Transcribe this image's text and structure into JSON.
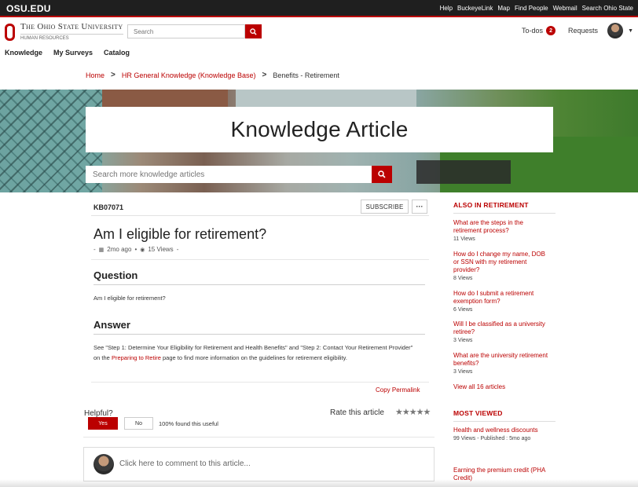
{
  "osu_bar": {
    "brand": "OSU.EDU",
    "links": [
      "Help",
      "BuckeyeLink",
      "Map",
      "Find People",
      "Webmail",
      "Search Ohio State"
    ]
  },
  "header": {
    "university": "The Ohio State University",
    "department": "HUMAN RESOURCES",
    "search_placeholder": "Search",
    "todos_label": "To-dos",
    "todos_count": "2",
    "requests_label": "Requests"
  },
  "nav": {
    "items": [
      "Knowledge",
      "My Surveys",
      "Catalog"
    ]
  },
  "breadcrumb": {
    "home": "Home",
    "parent": "HR General Knowledge (Knowledge Base)",
    "current": "Benefits - Retirement"
  },
  "hero": {
    "title": "Knowledge Article",
    "search_placeholder": "Search more knowledge articles"
  },
  "article": {
    "number": "KB07071",
    "subscribe_label": "SUBSCRIBE",
    "more_label": "···",
    "title": "Am I eligible for retirement?",
    "meta_age": "2mo ago",
    "meta_views": "15 Views",
    "question_heading": "Question",
    "question_text": "Am I eligible for retirement?",
    "answer_heading": "Answer",
    "answer_text_1": "See \"Step 1: Determine Your Eligibility for Retirement and Health Benefits\" and \"Step 2: Contact Your Retirement Provider\" on the ",
    "answer_link": "Preparing to Retire",
    "answer_text_2": " page to find more information on the guidelines for retirement eligibility.",
    "copy_permalink": "Copy Permalink"
  },
  "feedback": {
    "helpful_label": "Helpful?",
    "yes_label": "Yes",
    "no_label": "No",
    "useful_text": "100% found this useful",
    "rate_label": "Rate this article",
    "stars": "★★★★★",
    "comment_placeholder": "Click here to comment to this article..."
  },
  "sidebar": {
    "also_heading": "ALSO IN RETIREMENT",
    "also_items": [
      {
        "title": "What are the steps in the retirement process?",
        "views": "11 Views"
      },
      {
        "title": "How do I change my name, DOB or SSN with my retirement provider?",
        "views": "8 Views"
      },
      {
        "title": "How do I submit a retirement exemption form?",
        "views": "6 Views"
      },
      {
        "title": "Will I be classified as a university retiree?",
        "views": "3 Views"
      },
      {
        "title": "What are the university retirement benefits?",
        "views": "3 Views"
      }
    ],
    "view_all": "View all 16 articles",
    "most_heading": "MOST VIEWED",
    "most_items": [
      {
        "title": "Health and wellness discounts",
        "views": "99 Views  -  Published : 5mo ago"
      },
      {
        "title": "Earning the premium credit (PHA Credit)",
        "views": ""
      }
    ]
  },
  "colors": {
    "scarlet": "#bb0000",
    "topbar": "#1f1f1f"
  }
}
